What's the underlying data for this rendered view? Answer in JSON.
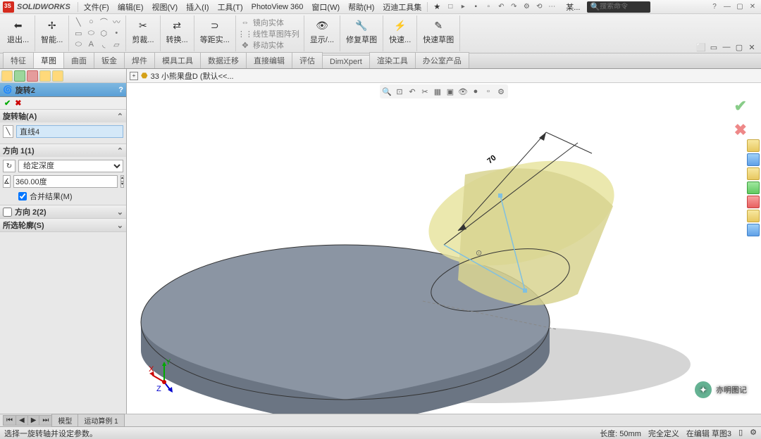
{
  "app": {
    "name": "SOLIDWORKS"
  },
  "menus": [
    "文件(F)",
    "编辑(E)",
    "视图(V)",
    "插入(I)",
    "工具(T)",
    "PhotoView 360",
    "窗口(W)",
    "帮助(H)",
    "迈迪工具集"
  ],
  "search_placeholder": "搜索命令",
  "ribbon": {
    "exit": "退出...",
    "smart": "智能...",
    "trim": "剪裁...",
    "convert": "转换...",
    "offset": "等距实...",
    "mirror": "镜向实体",
    "pattern": "线性草图阵列",
    "move": "移动实体",
    "display": "显示/...",
    "repair": "修复草图",
    "quick": "快速...",
    "fastsketch": "快速草图"
  },
  "tabs": [
    "特征",
    "草图",
    "曲面",
    "钣金",
    "焊件",
    "模具工具",
    "数据迁移",
    "直接编辑",
    "评估",
    "DimXpert",
    "渲染工具",
    "办公室产品"
  ],
  "active_tab": "草图",
  "tree_name": "33 小熊果盘D  (默认<<...",
  "feature": {
    "title": "旋转2",
    "axis_head": "旋转轴(A)",
    "axis_val": "直线4",
    "dir1_head": "方向 1(1)",
    "dir1_type": "给定深度",
    "angle": "360.00度",
    "merge": "合并结果(M)",
    "dir2_head": "方向 2(2)",
    "contour_head": "所选轮廓(S)"
  },
  "dim_label": "70",
  "bottom_tabs": [
    "模型",
    "运动算例 1"
  ],
  "status_left": "选择一旋转轴并设定参数。",
  "status_right": {
    "len": "长度: 50mm",
    "def": "完全定义",
    "edit": "在编辑 草图3"
  },
  "watermark": "亦明图记",
  "top_right_icons": [
    "⬜",
    "▭",
    "—",
    "▢",
    "✕"
  ]
}
